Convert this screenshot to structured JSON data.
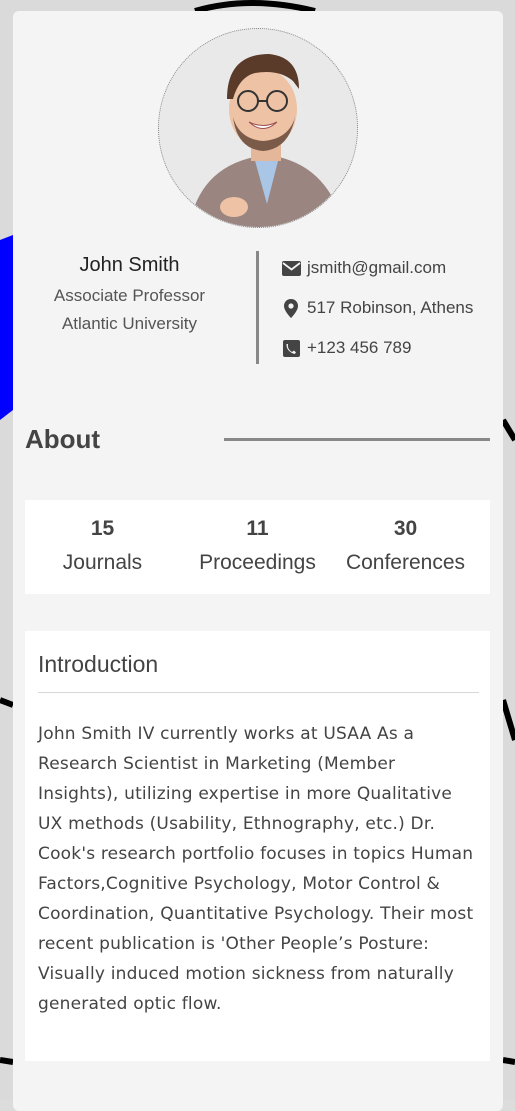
{
  "profile": {
    "name": "John Smith",
    "title": "Associate Professor",
    "institution": "Atlantic University",
    "avatar_icon": "profile-photo"
  },
  "contact": {
    "email": "jsmith@gmail.com",
    "address": "517 Robinson, Athens",
    "phone": "+123 456 789"
  },
  "about": {
    "heading": "About"
  },
  "stats": [
    {
      "value": "15",
      "label": "Journals"
    },
    {
      "value": "11",
      "label": "Proceedings"
    },
    {
      "value": "30",
      "label": "Conferences"
    }
  ],
  "introduction": {
    "heading": "Introduction",
    "body": "John Smith IV currently works at USAA As a Research Scientist in Marketing (Member Insights), utilizing expertise in more Qualitative UX methods (Usability, Ethnography, etc.) Dr. Cook's research portfolio focuses in topics Human Factors,Cognitive Psychology, Motor Control & Coordination, Quantitative Psychology. Their most recent publication is 'Other People’s Posture: Visually induced motion sickness from naturally generated optic flow."
  },
  "colors": {
    "card": "#f4f4f4",
    "panel": "#ffffff",
    "divider": "#888888",
    "text": "#444444",
    "bg_accent": "#0000ff"
  }
}
